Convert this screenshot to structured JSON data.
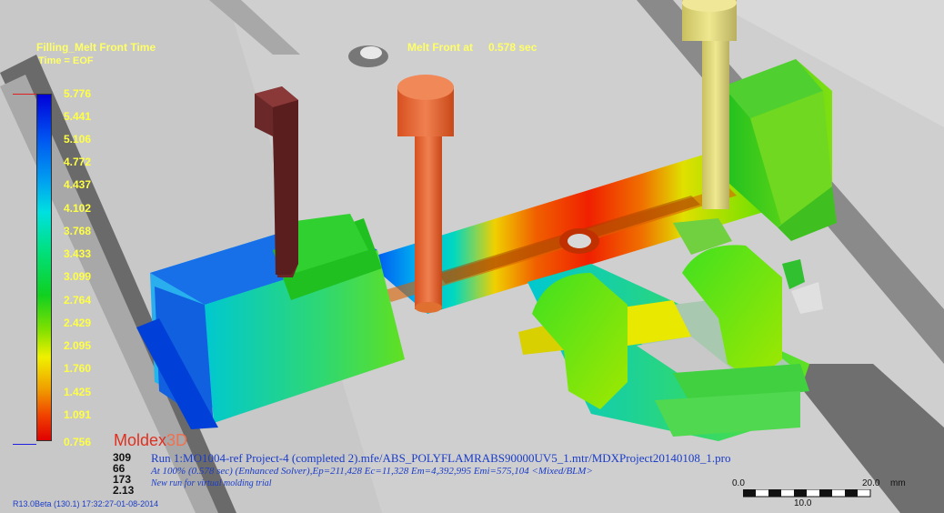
{
  "result": {
    "title": "Filling_Melt Front Time",
    "subtitle": "Time = EOF"
  },
  "melt_front": {
    "label": "Melt Front at",
    "value": "0.578 sec"
  },
  "legend": {
    "values": [
      "5.776",
      "5.441",
      "5.106",
      "4.772",
      "4.437",
      "4.102",
      "3.768",
      "3.433",
      "3.099",
      "2.764",
      "2.429",
      "2.095",
      "1.760",
      "1.425",
      "1.091",
      "0.756"
    ],
    "top_marker_color": "#e02020",
    "bottom_marker_color": "#2020e0"
  },
  "branding": {
    "logo_main": "Moldex",
    "logo_suffix": "3D"
  },
  "stats": [
    "309",
    "66",
    "173",
    "2.13"
  ],
  "info": {
    "line1": "Run 1:MO1004-ref Project-4 (completed 2).mfe/ABS_POLYFLAMRABS90000UV5_1.mtr/MDXProject20140108_1.pro",
    "line2": "At 100% (0.578 sec) (Enhanced Solver),Ep=211,428 Ec=11,328 Em=4,392,995 Emi=575,104 <Mixed/BLM>",
    "line3": "New run for virtual molding trial"
  },
  "version": "R13.0Beta (130.1) 17:32:27-01-08-2014",
  "scale": {
    "start": "0.0",
    "end": "20.0",
    "unit": "mm",
    "mid": "10.0"
  }
}
